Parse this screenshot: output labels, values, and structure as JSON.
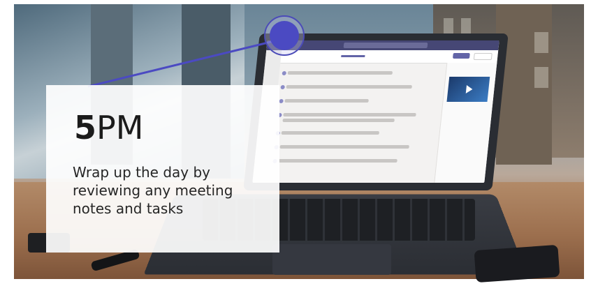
{
  "slide": {
    "time_number": "5",
    "time_suffix": "PM",
    "description": "Wrap up the day by reviewing any meeting notes and tasks",
    "accent_color": "#4b4ac2"
  },
  "photo": {
    "subject": "laptop-on-desk",
    "screen_app_icon": "teams-app-icon"
  }
}
